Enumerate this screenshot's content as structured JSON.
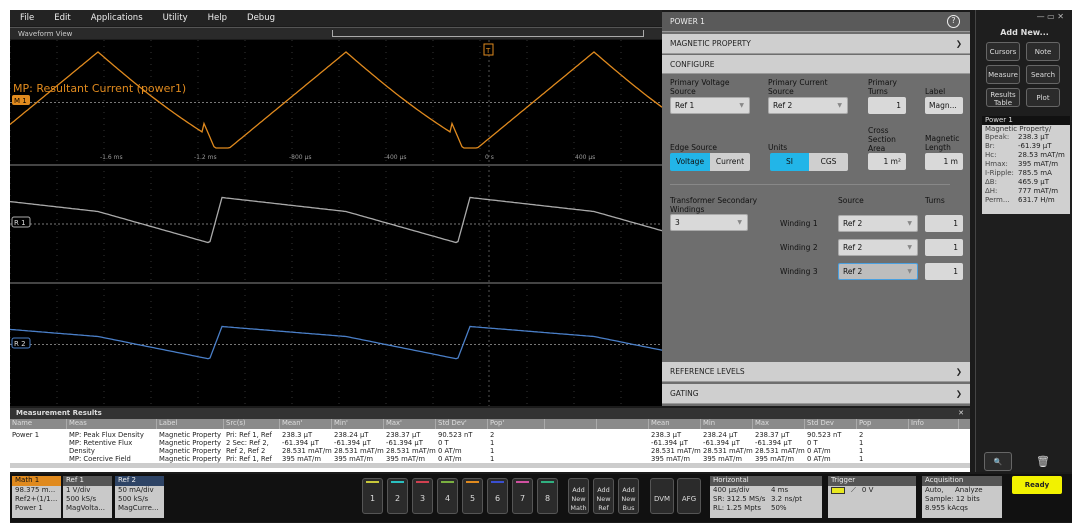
{
  "menu": [
    "File",
    "Edit",
    "Applications",
    "Utility",
    "Help",
    "Debug"
  ],
  "waveform_view": {
    "title": "Waveform View",
    "math_label": "MP: Resultant Current (power1)",
    "time_ticks": [
      "-1.6 ms",
      "-1.2 ms",
      "-800 µs",
      "-400 µs",
      "0 s",
      "400 µs"
    ],
    "markers": {
      "m1": "M 1",
      "r1": "R 1",
      "r2": "R 2",
      "trigger": "T"
    },
    "colors": {
      "math": "#e08a1e",
      "ref1": "#aaaaaa",
      "ref2": "#4a7fc8"
    }
  },
  "config": {
    "title": "POWER 1",
    "sections": {
      "magnetic_property": "MAGNETIC PROPERTY",
      "configure": "CONFIGURE",
      "reference_levels": "REFERENCE LEVELS",
      "gating": "GATING"
    },
    "primary_voltage_label": "Primary Voltage Source",
    "primary_voltage": "Ref 1",
    "primary_current_label": "Primary Current Source",
    "primary_current": "Ref 2",
    "primary_turns_label": "Primary Turns",
    "primary_turns": "1",
    "label_label": "Label",
    "label": "Magn...",
    "edge_source_label": "Edge Source",
    "edge_options": [
      "Voltage",
      "Current"
    ],
    "edge_selected": "Voltage",
    "units_label": "Units",
    "units_options": [
      "SI",
      "CGS"
    ],
    "units_selected": "SI",
    "cross_section_label": "Cross Section Area",
    "cross_section": "1 m²",
    "mag_length_label": "Magnetic Length",
    "mag_length": "1 m",
    "secondary_label": "Transformer Secondary Windings",
    "secondary": "3",
    "source_header": "Source",
    "turns_header": "Turns",
    "windings": [
      {
        "label": "Winding 1",
        "source": "Ref 2",
        "turns": "1"
      },
      {
        "label": "Winding 2",
        "source": "Ref 2",
        "turns": "1"
      },
      {
        "label": "Winding 3",
        "source": "Ref 2",
        "turns": "1"
      }
    ]
  },
  "sidebar": {
    "add_new": "Add New...",
    "buttons": [
      "Cursors",
      "Note",
      "Measure",
      "Search",
      "Results Table",
      "Plot"
    ],
    "badge": {
      "title": "Power 1",
      "subtitle": "Magnetic Property/",
      "rows": [
        [
          "Bpeak:",
          "238.3 µT"
        ],
        [
          "Br:",
          "-61.39 µT"
        ],
        [
          "Hc:",
          "28.53 mAT/m"
        ],
        [
          "Hmax:",
          "395 mAT/m"
        ],
        [
          "I-Ripple:",
          "785.5 mA"
        ],
        [
          "ΔB:",
          "465.9 µT"
        ],
        [
          "ΔH:",
          "777 mAT/m"
        ],
        [
          "Perm...",
          "631.7 H/m"
        ]
      ]
    }
  },
  "measurements": {
    "title": "Measurement Results",
    "headers": [
      "Name",
      "Meas",
      "Label",
      "Src(s)",
      "Mean'",
      "Min'",
      "Max'",
      "Std Dev'",
      "Pop'",
      "",
      "",
      "Mean",
      "Min",
      "Max",
      "Std Dev",
      "Pop",
      "Info"
    ],
    "rows": [
      [
        "Power 1",
        "MP: Peak Flux Density",
        "Magnetic Property",
        "Pri: Ref 1, Ref",
        "238.3 µT",
        "238.24 µT",
        "238.37 µT",
        "90.523 nT",
        "2",
        "",
        "",
        "238.3 µT",
        "238.24 µT",
        "238.37 µT",
        "90.523 nT",
        "2",
        ""
      ],
      [
        "",
        "MP: Retentive Flux",
        "Magnetic Property",
        "2 Sec: Ref 2,",
        "-61.394 µT",
        "-61.394 µT",
        "-61.394 µT",
        "0 T",
        "1",
        "",
        "",
        "-61.394 µT",
        "-61.394 µT",
        "-61.394 µT",
        "0 T",
        "1",
        ""
      ],
      [
        "",
        "Density",
        "Magnetic Property",
        "Ref 2, Ref 2",
        "28.531 mAT/m",
        "28.531 mAT/m",
        "28.531 mAT/m",
        "0 AT/m",
        "1",
        "",
        "",
        "28.531 mAT/m",
        "28.531 mAT/m",
        "28.531 mAT/m",
        "0 AT/m",
        "1",
        ""
      ],
      [
        "",
        "MP: Coercive Field",
        "Magnetic Property",
        "Pri: Ref 1, Ref",
        "395 mAT/m",
        "395 mAT/m",
        "395 mAT/m",
        "0 AT/m",
        "1",
        "",
        "",
        "395 mAT/m",
        "395 mAT/m",
        "395 mAT/m",
        "0 AT/m",
        "1",
        ""
      ]
    ]
  },
  "bottom": {
    "math1": {
      "title": "Math 1",
      "lines": [
        "98.375 m...",
        "Ref2+(1/1...",
        "Power 1"
      ]
    },
    "ref1": {
      "title": "Ref 1",
      "lines": [
        "1 V/div",
        "500 kS/s",
        "MagVolta..."
      ]
    },
    "ref2": {
      "title": "Ref 2",
      "lines": [
        "50 mA/div",
        "500 kS/s",
        "MagCurre..."
      ]
    },
    "channels": [
      {
        "n": "1",
        "color": "#c8c83a"
      },
      {
        "n": "2",
        "color": "#2ac0c0"
      },
      {
        "n": "3",
        "color": "#d04050"
      },
      {
        "n": "4",
        "color": "#7ab040"
      },
      {
        "n": "5",
        "color": "#e08a1e"
      },
      {
        "n": "6",
        "color": "#3a4fd0"
      },
      {
        "n": "7",
        "color": "#d050a0"
      },
      {
        "n": "8",
        "color": "#30b080"
      }
    ],
    "add_math": "Add New Math",
    "add_ref": "Add New Ref",
    "add_bus": "Add New Bus",
    "dvm": "DVM",
    "afg": "AFG",
    "horizontal": {
      "title": "Horizontal",
      "scale": "400 µs/div",
      "duration": "4 ms",
      "sr": "SR: 312.5 MS/s",
      "pt": "3.2 ns/pt",
      "rl": "RL: 1.25 Mpts",
      "pos": "50%"
    },
    "trigger": {
      "title": "Trigger",
      "level": "0 V"
    },
    "acquisition": {
      "title": "Acquisition",
      "mode": "Auto,",
      "analyze": "Analyze",
      "sample": "Sample: 12 bits",
      "acqs": "8.955 kAcqs"
    },
    "ready": "Ready"
  }
}
